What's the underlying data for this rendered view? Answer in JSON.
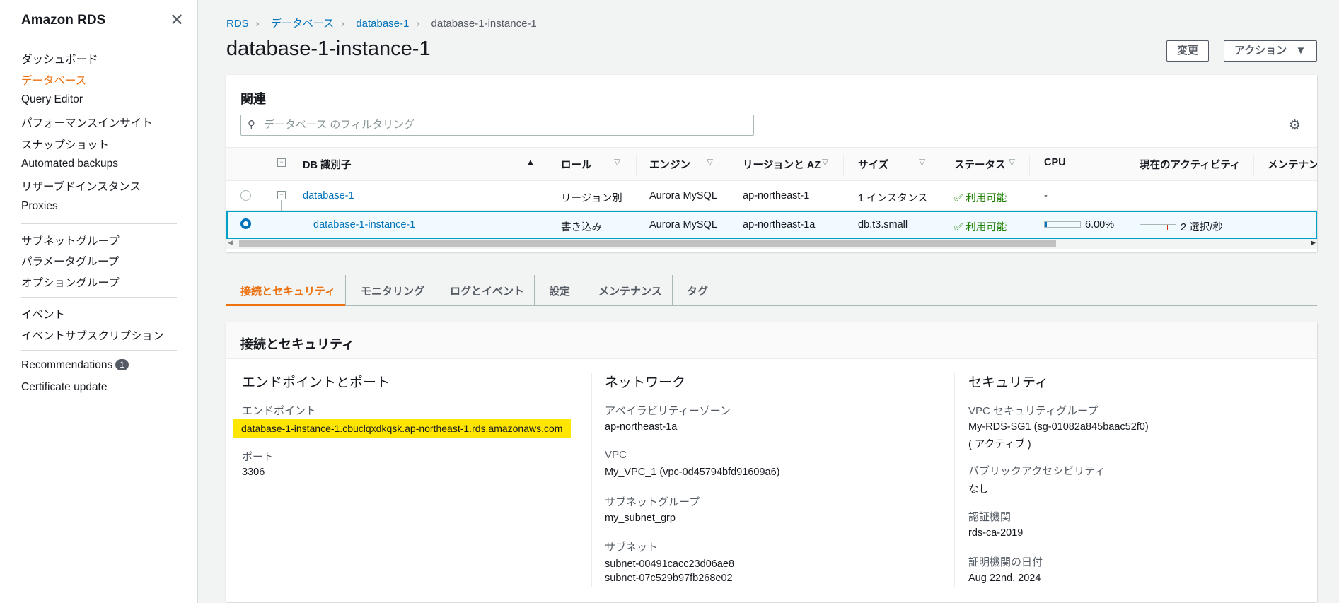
{
  "sidebar": {
    "title": "Amazon RDS",
    "groups": [
      [
        "ダッシュボード",
        "データベース",
        "Query Editor",
        "パフォーマンスインサイト",
        "スナップショット",
        "Automated backups",
        "リザーブドインスタンス",
        "Proxies"
      ],
      [
        "サブネットグループ",
        "パラメータグループ",
        "オプショングループ"
      ],
      [
        "イベント",
        "イベントサブスクリプション"
      ],
      [
        "Recommendations",
        "Certificate update"
      ]
    ],
    "active": "データベース",
    "recommendations_count": "1"
  },
  "breadcrumb": [
    "RDS",
    "データベース",
    "database-1",
    "database-1-instance-1"
  ],
  "title": "database-1-instance-1",
  "actions": {
    "modify": "変更",
    "actions": "アクション"
  },
  "related": {
    "heading": "関連",
    "filter_placeholder": "データベース のフィルタリング",
    "columns": [
      "DB 識別子",
      "ロール",
      "エンジン",
      "リージョンと AZ",
      "サイズ",
      "ステータス",
      "CPU",
      "現在のアクティビティ",
      "メンテナンス"
    ],
    "rows": [
      {
        "id": "database-1",
        "role": "リージョン別",
        "engine": "Aurora MySQL",
        "region": "ap-northeast-1",
        "size": "1 インスタンス",
        "status": "利用可能",
        "cpu": "-",
        "activity": "",
        "selected": false
      },
      {
        "id": "database-1-instance-1",
        "role": "書き込み",
        "engine": "Aurora MySQL",
        "region": "ap-northeast-1a",
        "size": "db.t3.small",
        "status": "利用可能",
        "cpu": "6.00%",
        "cpu_percent": 6,
        "activity": "2 選択/秒",
        "selected": true
      }
    ]
  },
  "tabs": [
    "接続とセキュリティ",
    "モニタリング",
    "ログとイベント",
    "設定",
    "メンテナンス",
    "タグ"
  ],
  "section": {
    "title": "接続とセキュリティ",
    "endpoint": {
      "heading": "エンドポイントとポート",
      "endpoint_label": "エンドポイント",
      "endpoint": "database-1-instance-1.cbuclqxdkqsk.ap-northeast-1.rds.amazonaws.com",
      "port_label": "ポート",
      "port": "3306"
    },
    "network": {
      "heading": "ネットワーク",
      "az_label": "アベイラビリティーゾーン",
      "az": "ap-northeast-1a",
      "vpc_label": "VPC",
      "vpc": "My_VPC_1 (vpc-0d45794bfd91609a6)",
      "subnet_group_label": "サブネットグループ",
      "subnet_group": "my_subnet_grp",
      "subnets_label": "サブネット",
      "subnets": [
        "subnet-00491cacc23d06ae8",
        "subnet-07c529b97fb268e02"
      ]
    },
    "security": {
      "heading": "セキュリティ",
      "sg_label": "VPC セキュリティグループ",
      "sg": "My-RDS-SG1 (sg-01082a845baac52f0)",
      "sg_status": "( アクティブ )",
      "public_label": "パブリックアクセシビリティ",
      "public": "なし",
      "ca_label": "認証機関",
      "ca": "rds-ca-2019",
      "ca_date_label": "証明機関の日付",
      "ca_date": "Aug 22nd, 2024"
    }
  }
}
